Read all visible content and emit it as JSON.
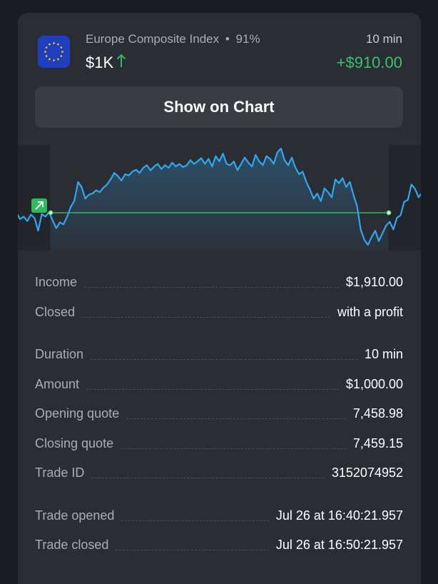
{
  "trade": {
    "asset_name": "Europe Composite Index",
    "payout": "91%",
    "separator": "•",
    "amount": "$1K",
    "direction_icon": "arrow-up-icon",
    "duration": "10 min",
    "profit": "+$910.00",
    "flag_icon": "eu-flag-icon"
  },
  "show_chart_button": "Show on Chart",
  "colors": {
    "profit": "#3cc06a",
    "line": "#2ea8ef",
    "open_line": "#2dbb5c",
    "card": "#2b2d34",
    "background": "#1b1c21"
  },
  "chart_data": {
    "type": "line",
    "title": "",
    "xlabel": "",
    "ylabel": "",
    "opening_quote": 7458.98,
    "closing_quote": 7459.15,
    "series": [
      {
        "values": [
          7458.98,
          7458.88,
          7458.92,
          7458.85,
          7458.95,
          7458.9,
          7458.7,
          7458.96,
          7458.92,
          7458.99,
          7458.86,
          7458.74,
          7458.83,
          7458.8,
          7458.92,
          7459.07,
          7459.17,
          7459.46,
          7459.38,
          7459.2,
          7459.26,
          7459.28,
          7459.33,
          7459.3,
          7459.37,
          7459.42,
          7459.5,
          7459.6,
          7459.55,
          7459.48,
          7459.58,
          7459.56,
          7459.62,
          7459.65,
          7459.6,
          7459.68,
          7459.72,
          7459.64,
          7459.7,
          7459.74,
          7459.66,
          7459.72,
          7459.68,
          7459.76,
          7459.7,
          7459.74,
          7459.69,
          7459.72,
          7459.8,
          7459.74,
          7459.78,
          7459.83,
          7459.74,
          7459.82,
          7459.7,
          7459.86,
          7459.78,
          7459.9,
          7459.74,
          7459.72,
          7459.78,
          7459.64,
          7459.74,
          7459.84,
          7459.76,
          7459.7,
          7459.88,
          7459.78,
          7459.72,
          7459.86,
          7459.82,
          7459.74,
          7459.92,
          7459.98,
          7459.8,
          7459.72,
          7459.84,
          7459.68,
          7459.58,
          7459.62,
          7459.46,
          7459.34,
          7459.2,
          7459.28,
          7459.16,
          7459.36,
          7459.3,
          7459.22,
          7459.5,
          7459.44,
          7459.52,
          7459.38,
          7459.46,
          7459.26,
          7459.08,
          7458.72,
          7458.56,
          7458.48,
          7458.6,
          7458.7,
          7458.54,
          7458.66,
          7458.78,
          7458.84,
          7458.72,
          7458.9,
          7458.94,
          7459.15,
          7459.18,
          7459.42,
          7459.35,
          7459.22,
          7459.3
        ]
      }
    ],
    "grid": false,
    "legend": "none"
  },
  "details": {
    "rows": [
      {
        "label": "Income",
        "value": "$1,910.00"
      },
      {
        "label": "Closed",
        "value": "with a profit"
      },
      {
        "label": "Duration",
        "value": "10 min"
      },
      {
        "label": "Amount",
        "value": "$1,000.00"
      },
      {
        "label": "Opening quote",
        "value": "7,458.98"
      },
      {
        "label": "Closing quote",
        "value": "7,459.15"
      },
      {
        "label": "Trade ID",
        "value": "3152074952"
      },
      {
        "label": "Trade opened",
        "value": "Jul 26 at 16:40:21.957"
      },
      {
        "label": "Trade closed",
        "value": "Jul 26 at 16:50:21.957"
      }
    ]
  }
}
